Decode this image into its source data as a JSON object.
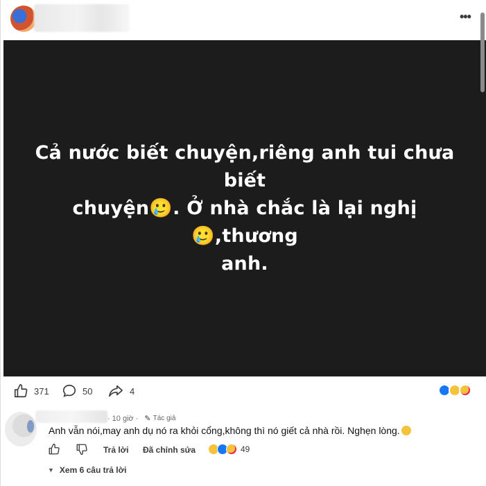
{
  "post": {
    "text": "Cả nước biết chuyện,riêng anh tui chưa biết\nchuyện🥲. Ở nhà chắc là lại nghị🥲,thương\nanh."
  },
  "actions": {
    "like_count": "371",
    "comment_count": "50",
    "share_count": "4"
  },
  "reactions": [
    "like",
    "sad",
    "care"
  ],
  "comment": {
    "time": "10 giờ",
    "author_badge": "Tác giả",
    "text": "Anh vẫn nói,may anh dụ nó ra khỏi cổng,không thì nó giết cả nhà rồi. Nghẹn lòng.",
    "reply_label": "Trả lời",
    "edited_label": "Đã chỉnh sửa",
    "reaction_count": "49",
    "view_replies": "Xem 6 câu trả lời"
  },
  "colors": {
    "image_bg": "#1c1c1c",
    "like_blue": "#1877f2",
    "sad_yellow": "#f5c33b",
    "care_red": "#f0284a"
  }
}
